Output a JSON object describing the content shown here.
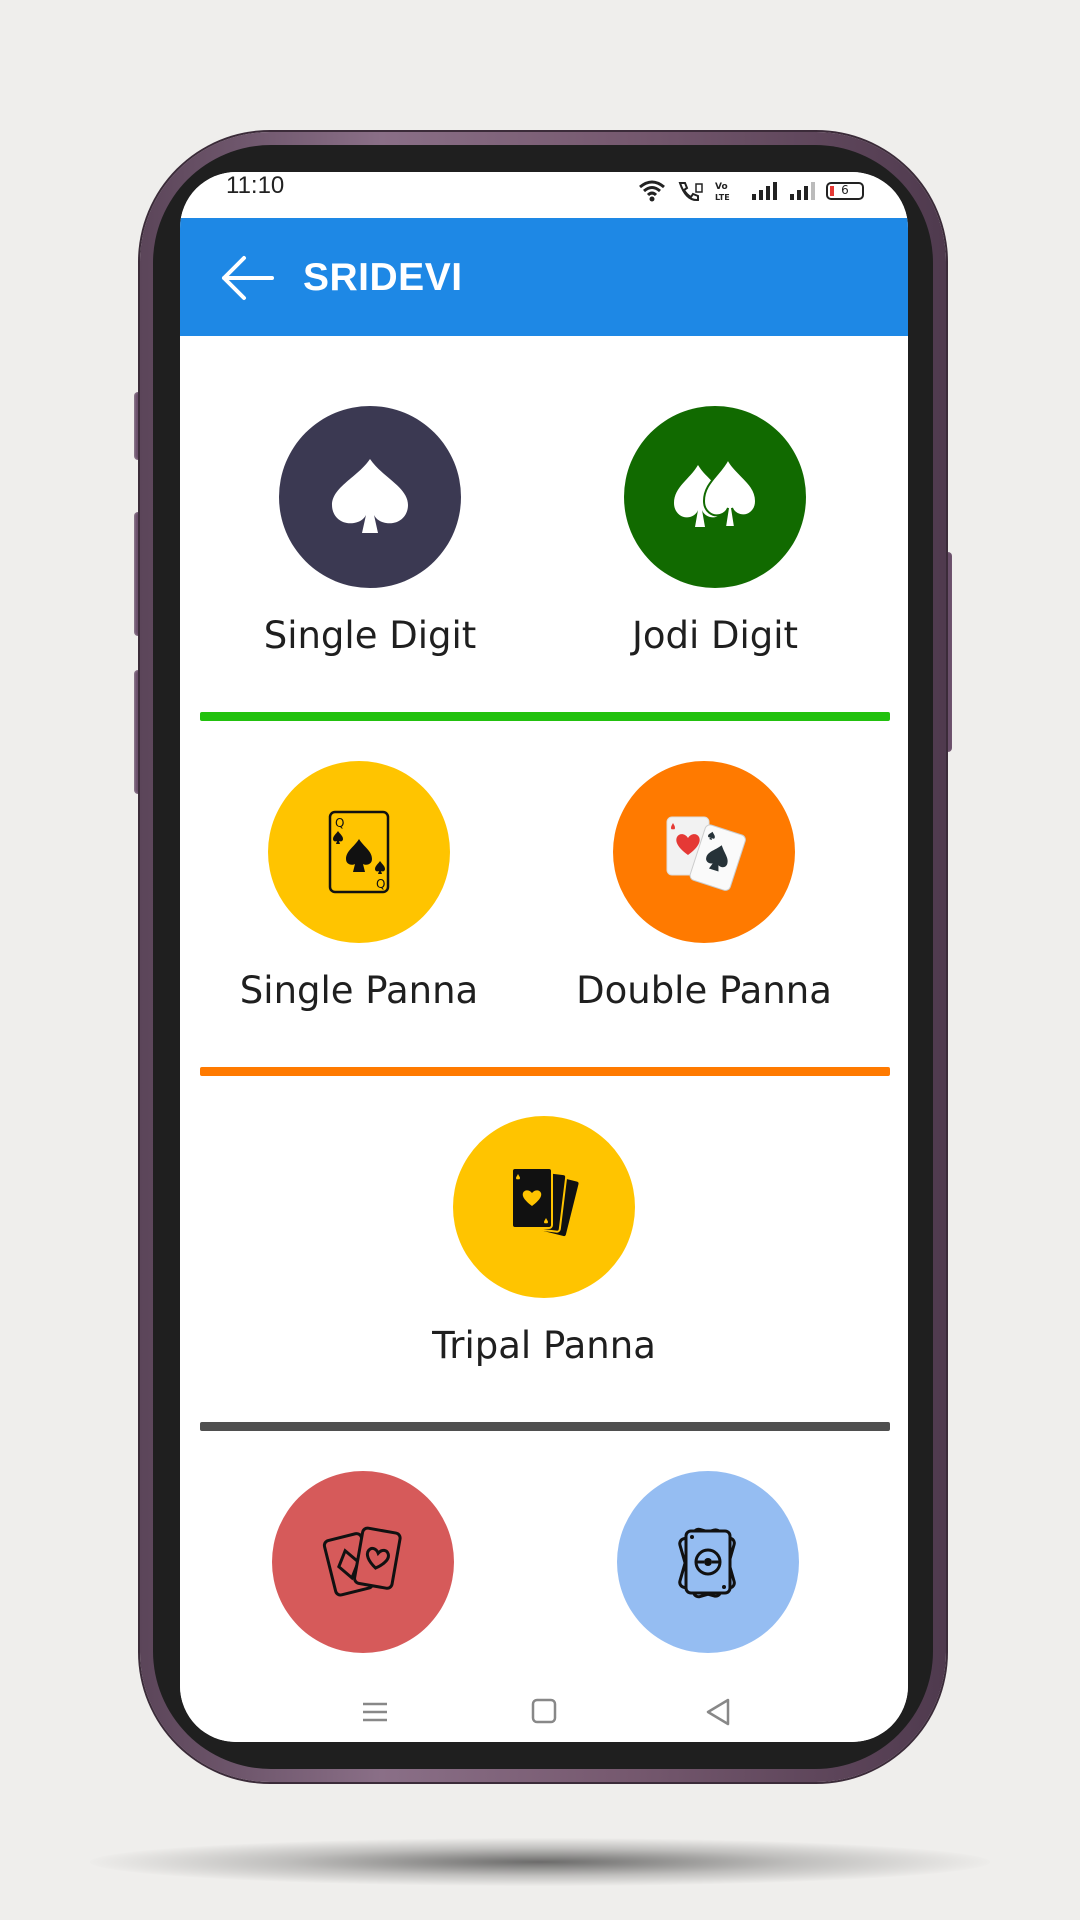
{
  "status_bar": {
    "time": "11:10",
    "battery_level": "6",
    "icons": [
      "wifi-icon",
      "wifi-calling-icon",
      "volte-icon",
      "signal-icon",
      "signal-icon",
      "battery-icon"
    ]
  },
  "app_bar": {
    "title": "SRIDEVI",
    "back_icon": "arrow-left-icon",
    "color": "#1e88e5"
  },
  "games": [
    {
      "label": "Single Digit",
      "color": "#3b3952",
      "icon": "spade-icon"
    },
    {
      "label": "Jodi Digit",
      "color": "#116a00",
      "icon": "double-spade-icon"
    },
    {
      "label": "Single Panna",
      "color": "#ffc400",
      "icon": "queen-card-icon"
    },
    {
      "label": "Double Panna",
      "color": "#ff7a00",
      "icon": "two-cards-icon"
    },
    {
      "label": "Tripal Panna",
      "color": "#ffc400",
      "icon": "card-stack-icon"
    },
    {
      "label": "",
      "color": "#d65a5a",
      "icon": "diamond-heart-cards-icon"
    },
    {
      "label": "",
      "color": "#95bdf2",
      "icon": "card-deck-icon"
    }
  ],
  "dividers": [
    "#22c10e",
    "#ff7a00",
    "#4f4f4f"
  ],
  "nav_bar": [
    "menu-icon",
    "home-icon",
    "back-triangle-icon"
  ]
}
